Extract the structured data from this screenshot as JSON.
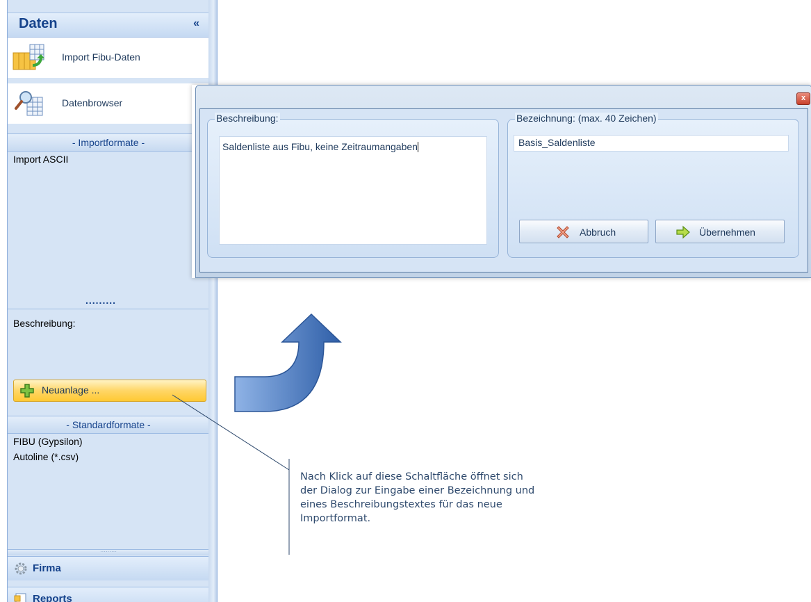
{
  "nav_pane": {
    "title": "Daten",
    "collapse_glyph": "«",
    "actions": [
      {
        "label": "Import Fibu-Daten",
        "icon": "table-import-icon"
      },
      {
        "label": "Datenbrowser",
        "icon": "magnifier-table-icon"
      }
    ],
    "import_section_title": "- Importformate -",
    "import_items": [
      "Import ASCII"
    ],
    "grip_dots": ".........",
    "description_label": "Beschreibung:",
    "new_button_label": "Neuanlage ...",
    "standard_section_title": "- Standardformate -",
    "standard_items": [
      "FIBU (Gypsilon)",
      "Autoline (*.csv)"
    ],
    "bottom_tabs": [
      {
        "label": "Firma",
        "icon": "gear-icon"
      },
      {
        "label": "Reports",
        "icon": "report-icon"
      }
    ]
  },
  "dialog": {
    "close_glyph": "x",
    "description_group_label": "Beschreibung:",
    "description_value": "Saldenliste aus Fibu, keine Zeitraumangaben",
    "name_group_label": "Bezeichnung:  (max. 40 Zeichen)",
    "name_value": "Basis_Saldenliste",
    "cancel_label": "Abbruch",
    "apply_label": "Übernehmen"
  },
  "annotation": {
    "text": "Nach Klick auf diese Schaltfläche öffnet sich der Dialog zur Eingabe einer Bezeichnung und eines Beschreibungstextes für das neue Importformat."
  },
  "colors": {
    "pane_background": "#d6e4f5",
    "header_text": "#15428b",
    "arrow_fill": "#5a86c8",
    "new_button": "#ffd666"
  }
}
